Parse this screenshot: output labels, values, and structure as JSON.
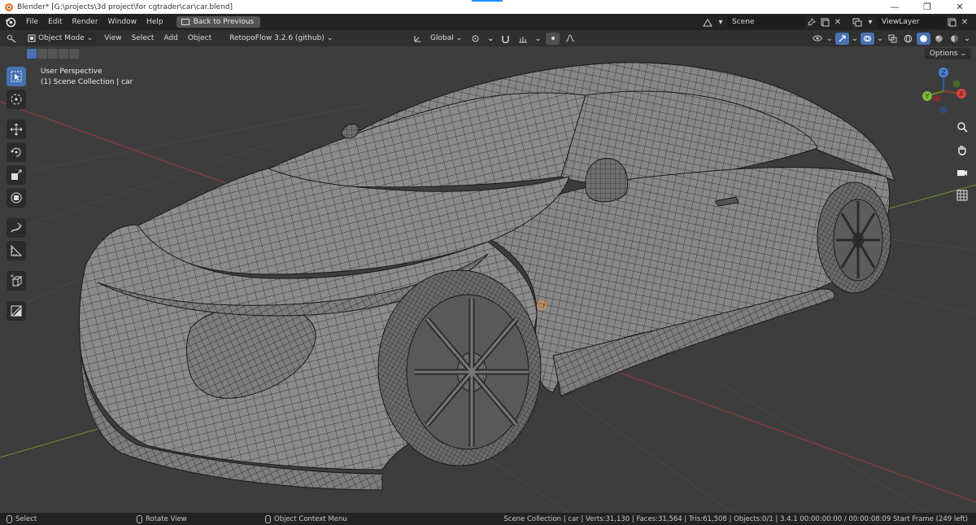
{
  "window": {
    "title": "Blender* [G:\\projects\\3d project\\for cgtrader\\car\\car.blend]",
    "minimize_glyph": "—",
    "maximize_glyph": "❐",
    "close_glyph": "✕"
  },
  "menubar": {
    "items": [
      "File",
      "Edit",
      "Render",
      "Window",
      "Help"
    ],
    "back_button": "Back to Previous",
    "scene_value": "Scene",
    "viewlayer_value": "ViewLayer"
  },
  "view_header": {
    "mode": "Object Mode",
    "menus": [
      "View",
      "Select",
      "Add",
      "Object"
    ],
    "addon": "RetopoFlow 3.2.6 (github)",
    "orientation": "Global",
    "options_label": "Options"
  },
  "viewport": {
    "perspective": "User Perspective",
    "collection": "(1) Scene Collection | car",
    "gizmo": {
      "x": "X",
      "y": "Y",
      "z": "Z"
    }
  },
  "statusbar": {
    "select": "Select",
    "rotate": "Rotate View",
    "context_menu": "Object Context Menu",
    "stats": "Scene Collection | car | Verts:31,130 | Faces:31,564 | Tris:61,508 | Objects:0/1 | 3.4.1   00:00:00:00 / 00:00:08:09  Start Frame (249 left)"
  },
  "colors": {
    "accent": "#4772b3",
    "grid_x_axis": "#9b3a3a",
    "grid_y_axis": "#6f8f2f",
    "mesh_fill": "#8a8a8a",
    "wire": "#1a1a1a"
  },
  "icons": {
    "select": "cursor-arrow-icon",
    "cursor": "3d-cursor-icon",
    "move": "move-icon",
    "rotate": "rotate-icon",
    "scale": "scale-icon",
    "transform": "transform-icon",
    "annotate": "annotate-icon",
    "measure": "measure-icon",
    "add_cube": "add-cube-icon",
    "retopo": "retopoflow-icon"
  }
}
